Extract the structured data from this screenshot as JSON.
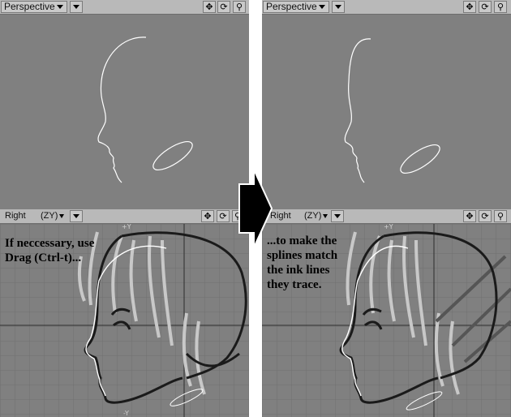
{
  "colors": {
    "viewport_bg": "#808080",
    "titlebar_bg": "#b9b9b9",
    "spline": "#ffffff",
    "ink": "#1a1a1a",
    "hair": "#c8c8c8"
  },
  "left": {
    "top_viewport": {
      "view_label": "Perspective",
      "icons": [
        "move-icon",
        "rotate-icon",
        "zoom-icon"
      ]
    },
    "bottom_viewport": {
      "view_label": "Right",
      "axis_label": "(ZY)",
      "icons": [
        "move-icon",
        "rotate-icon",
        "zoom-icon"
      ],
      "axis_top": "+Y",
      "axis_bottom": "-Y"
    },
    "caption": "If neccessary, use\nDrag (Ctrl-t)..."
  },
  "right": {
    "top_viewport": {
      "view_label": "Perspective",
      "icons": [
        "move-icon",
        "rotate-icon",
        "zoom-icon"
      ]
    },
    "bottom_viewport": {
      "view_label": "Right",
      "axis_label": "(ZY)",
      "icons": [
        "move-icon",
        "rotate-icon",
        "zoom-icon"
      ],
      "axis_top": "+Y"
    },
    "caption": "...to make the\nsplines match\nthe ink lines\nthey trace."
  },
  "glyphs": {
    "move": "✥",
    "rotate": "⟳",
    "zoom": "⚲"
  }
}
